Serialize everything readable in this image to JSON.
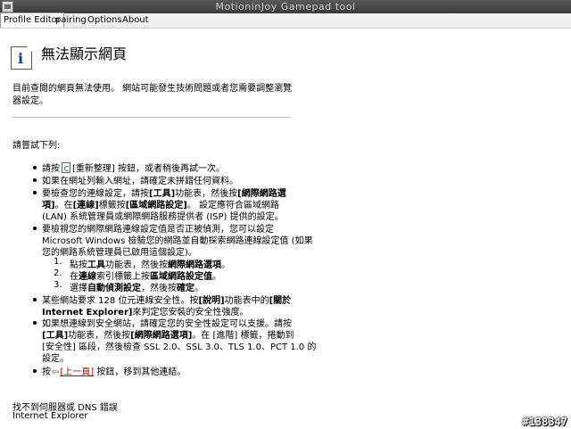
{
  "window": {
    "title": "MotioninJoy Gamepad tool"
  },
  "menu": [
    "Profile Editor",
    "pairing",
    "Options",
    "About"
  ],
  "page": {
    "heading": "無法顯示網頁",
    "intro_1": "目前查閱的網頁無法使用。 網站可能發生技術問題或者您需要調整瀏覽",
    "intro_2": "器設定。",
    "try_label": "請嘗試下列:",
    "b1_pre": "請按",
    "b1_post": "[重新整理] 按鈕，或者稍後再試一次。",
    "b2": "如果在網址列輸入網址，請確定未拼錯任何資料。",
    "b3_1a": "要檢查您的連線設定，請按",
    "b3_1b": "[工具]",
    "b3_1c": "功能表，然後按",
    "b3_1d": "[網際網路選",
    "b3_2a": "項]",
    "b3_2b": "。在",
    "b3_2c": "[連線]",
    "b3_2d": "標籤按",
    "b3_2e": "[區域網路設定]",
    "b3_2f": "。 設定應符合區域網路",
    "b3_3": "(LAN) 系統管理員或網際網路服務提供者 (ISP) 提供的設定。",
    "b4_1": "要檢視您的網際網路連線設定值是否正被偵測，您可以設定",
    "b4_2": "Microsoft Windows 檢驗您的網路並自動探索網路連線設定值 (如果",
    "b4_3": "您的網路系統管理員已啟用這個設定)。",
    "s1_num": "1.",
    "s1a": "點按",
    "s1b": "工具",
    "s1c": "功能表，然後按",
    "s1d": "網際網路選項",
    "s1e": "。",
    "s2_num": "2.",
    "s2a": "在",
    "s2b": "連線",
    "s2c": "索引標籤上按",
    "s2d": "區域網路設定值",
    "s2e": "。",
    "s3_num": "3.",
    "s3a": "選擇",
    "s3b": "自動偵測設定",
    "s3c": "，然後按",
    "s3d": "確定",
    "s3e": "。",
    "b5_1a": "某些網站要求 128 位元連線安全性。按",
    "b5_1b": "[說明]",
    "b5_1c": "功能表中的",
    "b5_1d": "[關於",
    "b5_2a": "Internet Explorer]",
    "b5_2b": "來判定您安裝的安全性強度。",
    "b6_1": "如果想連線到安全網站，請確定您的安全性設定可以支援。請按",
    "b6_2a": "[工具]",
    "b6_2b": "功能表，然後按",
    "b6_2c": "[網際網路選項]",
    "b6_2d": "。在 [進階] 標籤，捲動到",
    "b6_3": "[安全性] 區段，然後檢查 SSL 2.0、SSL 3.0、TLS 1.0、PCT 1.0 的",
    "b6_4": "設定。",
    "b7_pre": "按",
    "b7_link": "[上一頁]",
    "b7_post": " 按鈕，移到其他連結。",
    "footer_1": "找不到伺服器或 DNS 錯誤",
    "footer_2": "Internet Explorer"
  },
  "watermark": "#138347",
  "icons": {
    "app": "app-icon",
    "info": "info-icon",
    "refresh": "refresh-icon",
    "back": "back-arrow-icon"
  }
}
